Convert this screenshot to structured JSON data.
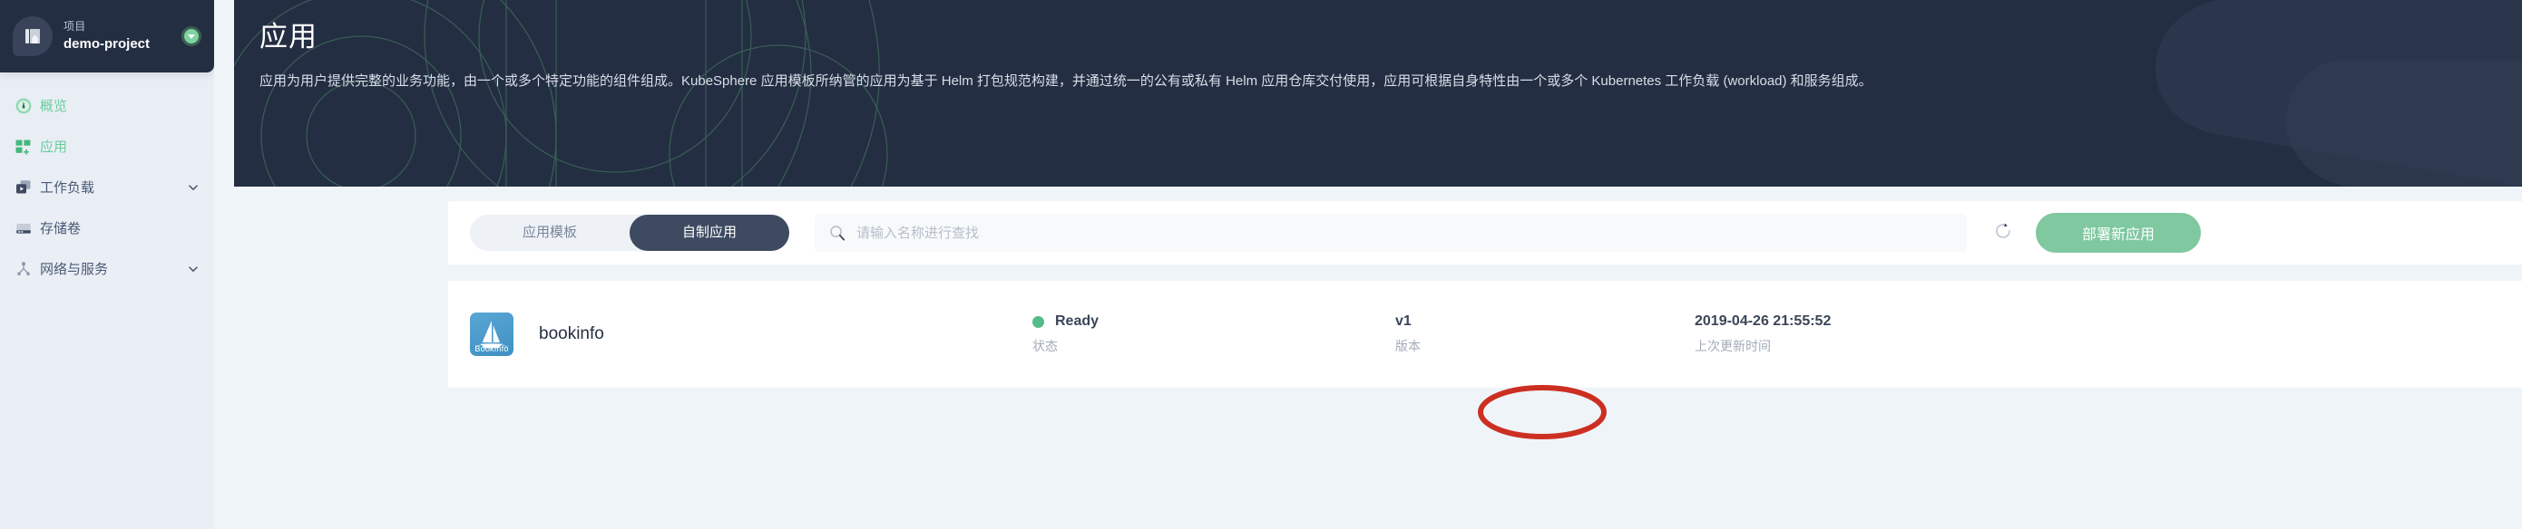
{
  "sidebar": {
    "project": {
      "label": "项目",
      "name": "demo-project",
      "avatar_icon": "project-board-icon",
      "toggle_icon": "chevron-down-icon"
    },
    "items": [
      {
        "label": "概览",
        "icon": "dashboard-icon",
        "active": true,
        "expandable": false
      },
      {
        "label": "应用",
        "icon": "apps-grid-icon",
        "active": true,
        "expandable": false
      },
      {
        "label": "工作负载",
        "icon": "workload-icon",
        "active": false,
        "expandable": true
      },
      {
        "label": "存储卷",
        "icon": "volume-icon",
        "active": false,
        "expandable": false
      },
      {
        "label": "网络与服务",
        "icon": "network-icon",
        "active": false,
        "expandable": true
      }
    ]
  },
  "banner": {
    "title": "应用",
    "description": "应用为用户提供完整的业务功能，由一个或多个特定功能的组件组成。KubeSphere 应用模板所纳管的应用为基于 Helm 打包规范构建，并通过统一的公有或私有 Helm 应用仓库交付使用，应用可根据自身特性由一个或多个 Kubernetes 工作负载 (workload) 和服务组成。"
  },
  "toolbar": {
    "tabs": [
      {
        "label": "应用模板",
        "active": false
      },
      {
        "label": "自制应用",
        "active": true
      }
    ],
    "search": {
      "placeholder": "请输入名称进行查找",
      "value": "",
      "icon": "search-icon"
    },
    "refresh_icon": "refresh-icon",
    "deploy_label": "部署新应用"
  },
  "table": {
    "columns": [
      "",
      "状态",
      "版本",
      "上次更新时间"
    ],
    "rows": [
      {
        "icon": "bookinfo-app-icon",
        "icon_caption": "BookInfo",
        "name": "bookinfo",
        "status": "Ready",
        "status_sub": "状态",
        "version": "v1",
        "version_sub": "版本",
        "updated": "2019-04-26 21:55:52",
        "updated_sub": "上次更新时间"
      }
    ]
  },
  "annotation": {
    "shape": "red-ellipse-highlight",
    "target": "status-ready"
  },
  "colors": {
    "dark_navy": "#242e42",
    "accent_green": "#7fc8a0",
    "status_green": "#55bc8a",
    "annotation_red": "#cc2f22",
    "page_bg": "#eff4f9"
  }
}
